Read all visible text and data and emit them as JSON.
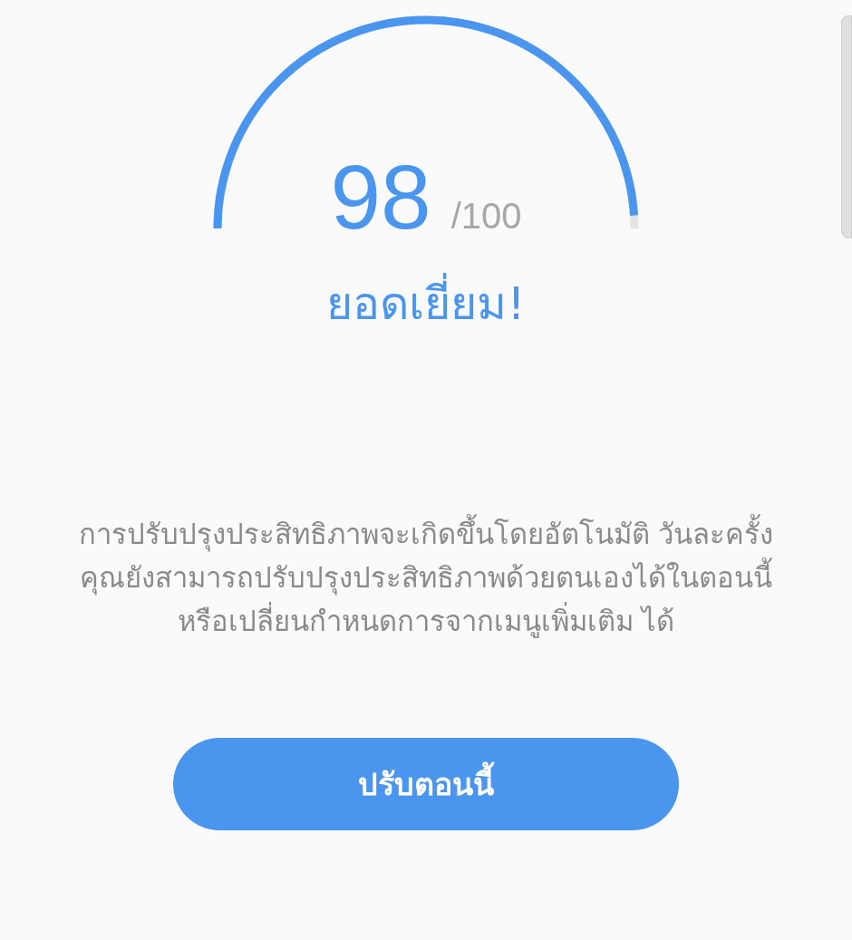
{
  "score_gauge": {
    "level": 0.98,
    "score": "98",
    "max": "/100"
  },
  "rating": "ยอดเยี่ยม!",
  "description": "การปรับปรุงประสิทธิภาพจะเกิดขึ้นโดยอัตโนมัติ วันละครั้ง คุณยังสามารถปรับปรุงประสิทธิภาพด้วยตนเองได้ในตอนนี้ หรือเปลี่ยนกำหนดการจากเมนูเพิ่มเติม ได้",
  "button": {
    "label": "ปรับตอนนี้"
  }
}
